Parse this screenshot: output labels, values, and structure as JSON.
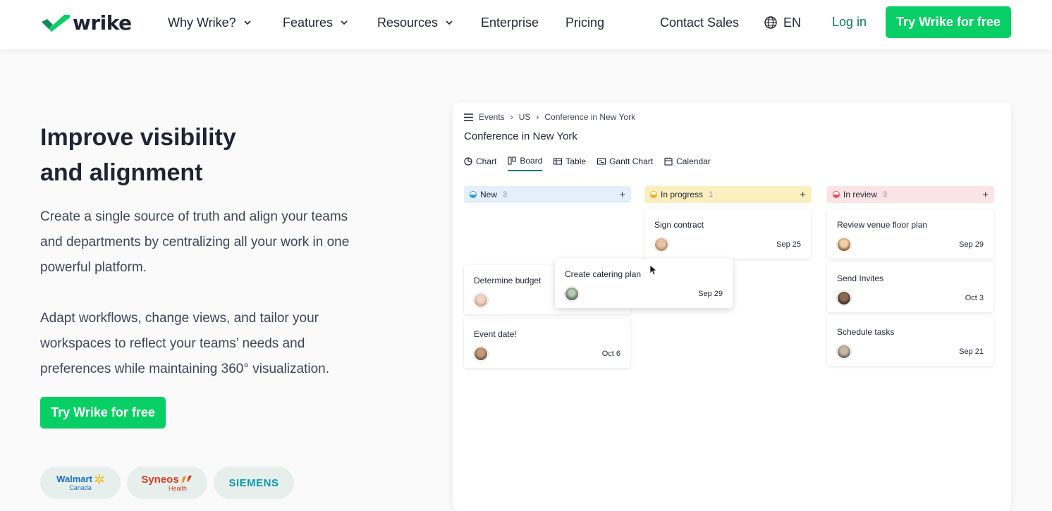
{
  "nav": {
    "brand": "wrike",
    "items": [
      {
        "label": "Why Wrike?",
        "has_dropdown": true
      },
      {
        "label": "Features",
        "has_dropdown": true
      },
      {
        "label": "Resources",
        "has_dropdown": true
      },
      {
        "label": "Enterprise",
        "has_dropdown": false
      },
      {
        "label": "Pricing",
        "has_dropdown": false
      }
    ],
    "contact_sales": "Contact Sales",
    "language": "EN",
    "login": "Log in",
    "cta": "Try Wrike for free",
    "brand_color": "#08cf65"
  },
  "hero": {
    "heading_line1": "Improve visibility",
    "heading_line2": "and alignment",
    "paragraph1": "Create a single source of truth and align your teams and departments by centralizing all your work in one powerful platform.",
    "paragraph2": "Adapt workflows, change views, and tailor your workspaces to reflect your teams’ needs and preferences while maintaining 360° visualization.",
    "cta": "Try Wrike for free",
    "customer_logos": [
      {
        "name": "Walmart",
        "sub": "Canada"
      },
      {
        "name": "Syneos",
        "sub": "Health"
      },
      {
        "name": "SIEMENS",
        "sub": ""
      }
    ]
  },
  "app": {
    "breadcrumbs": [
      "Events",
      "US",
      "Conference in New York"
    ],
    "title": "Conference in New York",
    "views": [
      {
        "label": "Chart",
        "icon": "pie-chart-icon",
        "active": false
      },
      {
        "label": "Board",
        "icon": "board-icon",
        "active": true
      },
      {
        "label": "Table",
        "icon": "table-icon",
        "active": false
      },
      {
        "label": "Gantt Chart",
        "icon": "gantt-icon",
        "active": false
      },
      {
        "label": "Calendar",
        "icon": "calendar-icon",
        "active": false
      }
    ],
    "columns": [
      {
        "label": "New",
        "count": "3",
        "bg": "#e3f0fb",
        "dot": "#2e9bdc"
      },
      {
        "label": "In progress",
        "count": "1",
        "bg": "#fbefbf",
        "dot": "#e5b316"
      },
      {
        "label": "In review",
        "count": "3",
        "bg": "#fbe3e6",
        "dot": "#e0516a"
      }
    ],
    "tasks": [
      {
        "name": "Sign contract",
        "date": "Sep 25"
      },
      {
        "name": "Create catering plan",
        "date": "Sep 29"
      },
      {
        "name": "Determine budget",
        "date": ""
      },
      {
        "name": "Event date!",
        "date": "Oct 6"
      },
      {
        "name": "Review venue floor plan",
        "date": "Sep 29"
      },
      {
        "name": "Send Invites",
        "date": "Oct 3"
      },
      {
        "name": "Schedule tasks",
        "date": "Sep 21"
      }
    ]
  }
}
